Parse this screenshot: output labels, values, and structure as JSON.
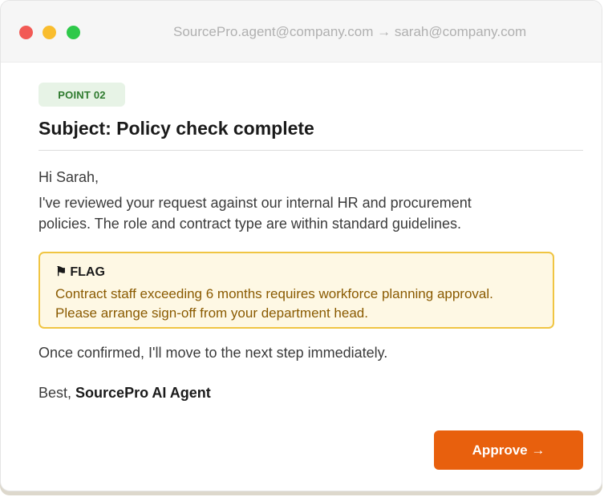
{
  "window": {
    "address": "SourcePro.agent@company.com → sarah@company.com"
  },
  "email": {
    "badge": "POINT 02",
    "subject": "Subject: Policy check complete",
    "greeting": "Hi Sarah,",
    "body_line1": "I've reviewed your request against our internal HR and procurement",
    "body_line2": "policies. The role and contract type are within standard guidelines.",
    "flag": {
      "icon": "⚑",
      "title": "FLAG",
      "line1": "Contract staff exceeding 6 months requires workforce planning approval.",
      "line2": "Please arrange sign-off from your department head."
    },
    "closing_line": "Once confirmed, I'll move to the next step immediately.",
    "sign_prefix": "Best,",
    "sign_name": "SourcePro AI Agent"
  },
  "actions": {
    "approve_label": "Approve →"
  },
  "colors": {
    "accent": "#e8600d",
    "badge_bg": "#e7f3e6",
    "badge_text": "#2e7a2e",
    "flag_bg": "#fef8e4",
    "flag_border": "#f0c543",
    "flag_text": "#8a5a00"
  }
}
